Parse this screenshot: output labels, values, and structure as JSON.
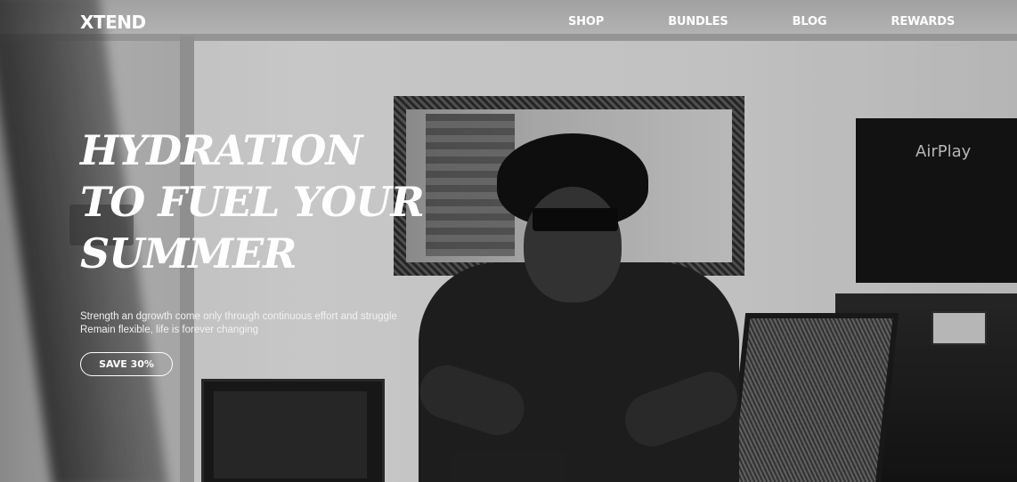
{
  "brand": {
    "logo_text": "XTEND"
  },
  "nav": {
    "items": [
      {
        "label": "SHOP"
      },
      {
        "label": "BUNDLES"
      },
      {
        "label": "BLOG"
      },
      {
        "label": "REWARDS"
      }
    ]
  },
  "hero": {
    "headline_lines": [
      "Hydration",
      "to fuel your",
      "summer"
    ],
    "subtext_lines": [
      "Strength an dgrowth come only through continuous effort and struggle",
      "Remain flexible, life is forever changing"
    ],
    "cta_label": "SAVE 30%",
    "background_photo_text": "AirPlay"
  },
  "colors": {
    "text": "#ffffff",
    "photo_tone": "grayscale"
  }
}
